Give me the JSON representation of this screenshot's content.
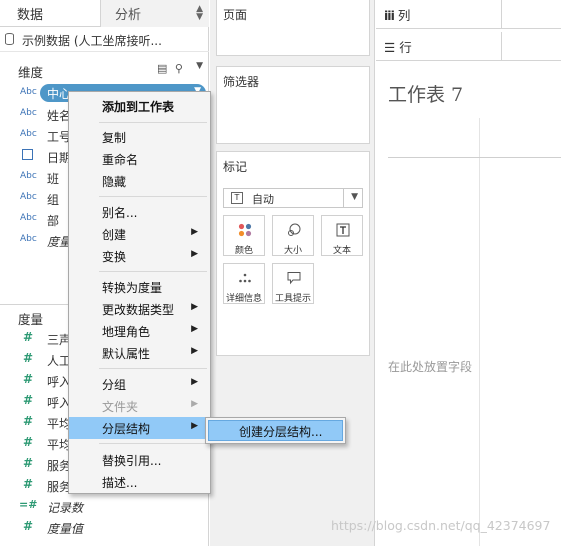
{
  "left_pane": {
    "tab_data": "数据",
    "tab_analysis": "分析",
    "datasource": "示例数据 (人工坐席接听...",
    "dimensions_header": "维度",
    "measures_header": "度量",
    "dimensions": [
      {
        "type": "Abc",
        "label": "中心",
        "selected": true
      },
      {
        "type": "Abc",
        "label": "姓名"
      },
      {
        "type": "Abc",
        "label": "工号"
      },
      {
        "type": "calendar",
        "label": "日期"
      },
      {
        "type": "Abc",
        "label": "班"
      },
      {
        "type": "Abc",
        "label": "组"
      },
      {
        "type": "Abc",
        "label": "部"
      },
      {
        "type": "Abc",
        "label": "度量",
        "italic": true
      }
    ],
    "measures": [
      {
        "type": "#",
        "label": "三声"
      },
      {
        "type": "#",
        "label": "人工"
      },
      {
        "type": "#",
        "label": "呼入"
      },
      {
        "type": "#",
        "label": "呼入"
      },
      {
        "type": "#",
        "label": "平均"
      },
      {
        "type": "#",
        "label": "平均"
      },
      {
        "type": "#",
        "label": "服务"
      },
      {
        "type": "#",
        "label": "服务"
      },
      {
        "type": "=#",
        "label": "记录数",
        "italic": true
      },
      {
        "type": "#",
        "label": "度量值",
        "italic": true
      }
    ]
  },
  "shelves": {
    "pages": "页面",
    "filters": "筛选器",
    "marks": "标记",
    "marks_type": "自动",
    "marks_buttons": [
      "颜色",
      "大小",
      "文本",
      "详细信息",
      "工具提示"
    ],
    "columns": "列",
    "rows": "行"
  },
  "canvas": {
    "sheet_title": "工作表 7",
    "drop_hint": "在此处放置字段"
  },
  "context_menu": {
    "items": [
      {
        "label": "添加到工作表",
        "bold": true
      },
      {
        "label": "复制"
      },
      {
        "label": "重命名"
      },
      {
        "label": "隐藏"
      },
      {
        "label": "别名..."
      },
      {
        "label": "创建",
        "submenu": true
      },
      {
        "label": "变换",
        "submenu": true
      },
      {
        "label": "转换为度量"
      },
      {
        "label": "更改数据类型",
        "submenu": true
      },
      {
        "label": "地理角色",
        "submenu": true
      },
      {
        "label": "默认属性",
        "submenu": true
      },
      {
        "label": "分组",
        "submenu": true
      },
      {
        "label": "文件夹",
        "submenu": true,
        "disabled": true
      },
      {
        "label": "分层结构",
        "submenu": true,
        "highlighted": true
      },
      {
        "label": "替换引用..."
      },
      {
        "label": "描述..."
      }
    ],
    "submenu_item": "创建分层结构..."
  },
  "watermark": "https://blog.csdn.net/qq_42374697",
  "colors": {
    "pill": "#4e97c8",
    "highlight": "#91c9f7",
    "dimension_icon": "#3c73b6",
    "measure_icon": "#2e9a74"
  }
}
